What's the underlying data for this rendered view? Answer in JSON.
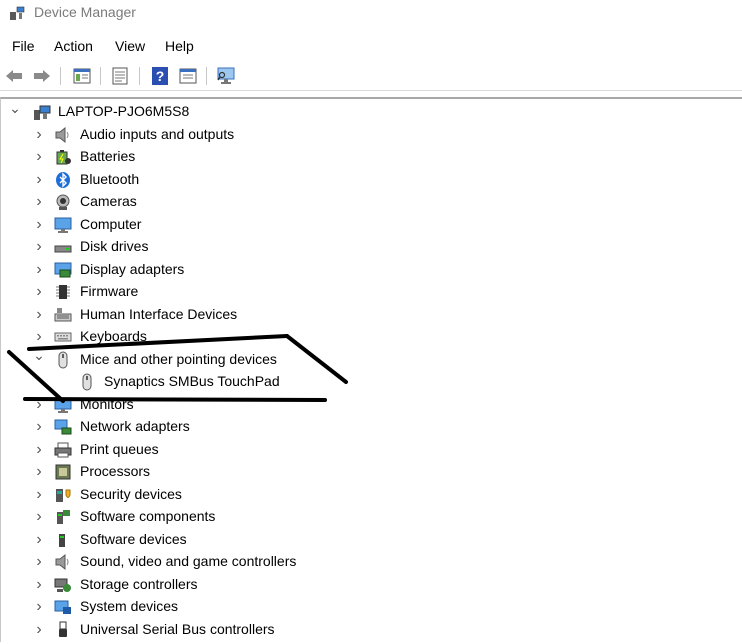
{
  "window": {
    "title": "Device Manager"
  },
  "menu": {
    "file": "File",
    "action": "Action",
    "view": "View",
    "help": "Help"
  },
  "toolbar": {
    "buttons": [
      "back-icon",
      "forward-icon",
      "show-hide-tree-icon",
      "properties-icon",
      "help-icon",
      "run-icon",
      "scan-hardware-icon"
    ]
  },
  "tree": {
    "root": {
      "label": "LAPTOP-PJO6M5S8",
      "icon": "computer-icon"
    },
    "categories": [
      {
        "label": "Audio inputs and outputs",
        "icon": "speaker-icon"
      },
      {
        "label": "Batteries",
        "icon": "battery-icon"
      },
      {
        "label": "Bluetooth",
        "icon": "bluetooth-icon"
      },
      {
        "label": "Cameras",
        "icon": "camera-icon"
      },
      {
        "label": "Computer",
        "icon": "monitor-icon"
      },
      {
        "label": "Disk drives",
        "icon": "disk-drive-icon"
      },
      {
        "label": "Display adapters",
        "icon": "display-adapter-icon"
      },
      {
        "label": "Firmware",
        "icon": "chip-icon"
      },
      {
        "label": "Human Interface Devices",
        "icon": "hid-icon"
      },
      {
        "label": "Keyboards",
        "icon": "keyboard-icon"
      },
      {
        "label": "Mice and other pointing devices",
        "icon": "mouse-icon",
        "expanded": true,
        "children": [
          {
            "label": "Synaptics SMBus TouchPad",
            "icon": "mouse-icon"
          }
        ]
      },
      {
        "label": "Monitors",
        "icon": "monitor-icon"
      },
      {
        "label": "Network adapters",
        "icon": "network-icon"
      },
      {
        "label": "Print queues",
        "icon": "printer-icon"
      },
      {
        "label": "Processors",
        "icon": "processor-icon"
      },
      {
        "label": "Security devices",
        "icon": "security-icon"
      },
      {
        "label": "Software components",
        "icon": "software-component-icon"
      },
      {
        "label": "Software devices",
        "icon": "software-device-icon"
      },
      {
        "label": "Sound, video and game controllers",
        "icon": "speaker-icon"
      },
      {
        "label": "Storage controllers",
        "icon": "storage-icon"
      },
      {
        "label": "System devices",
        "icon": "system-icon"
      },
      {
        "label": "Universal Serial Bus controllers",
        "icon": "usb-icon"
      }
    ]
  }
}
